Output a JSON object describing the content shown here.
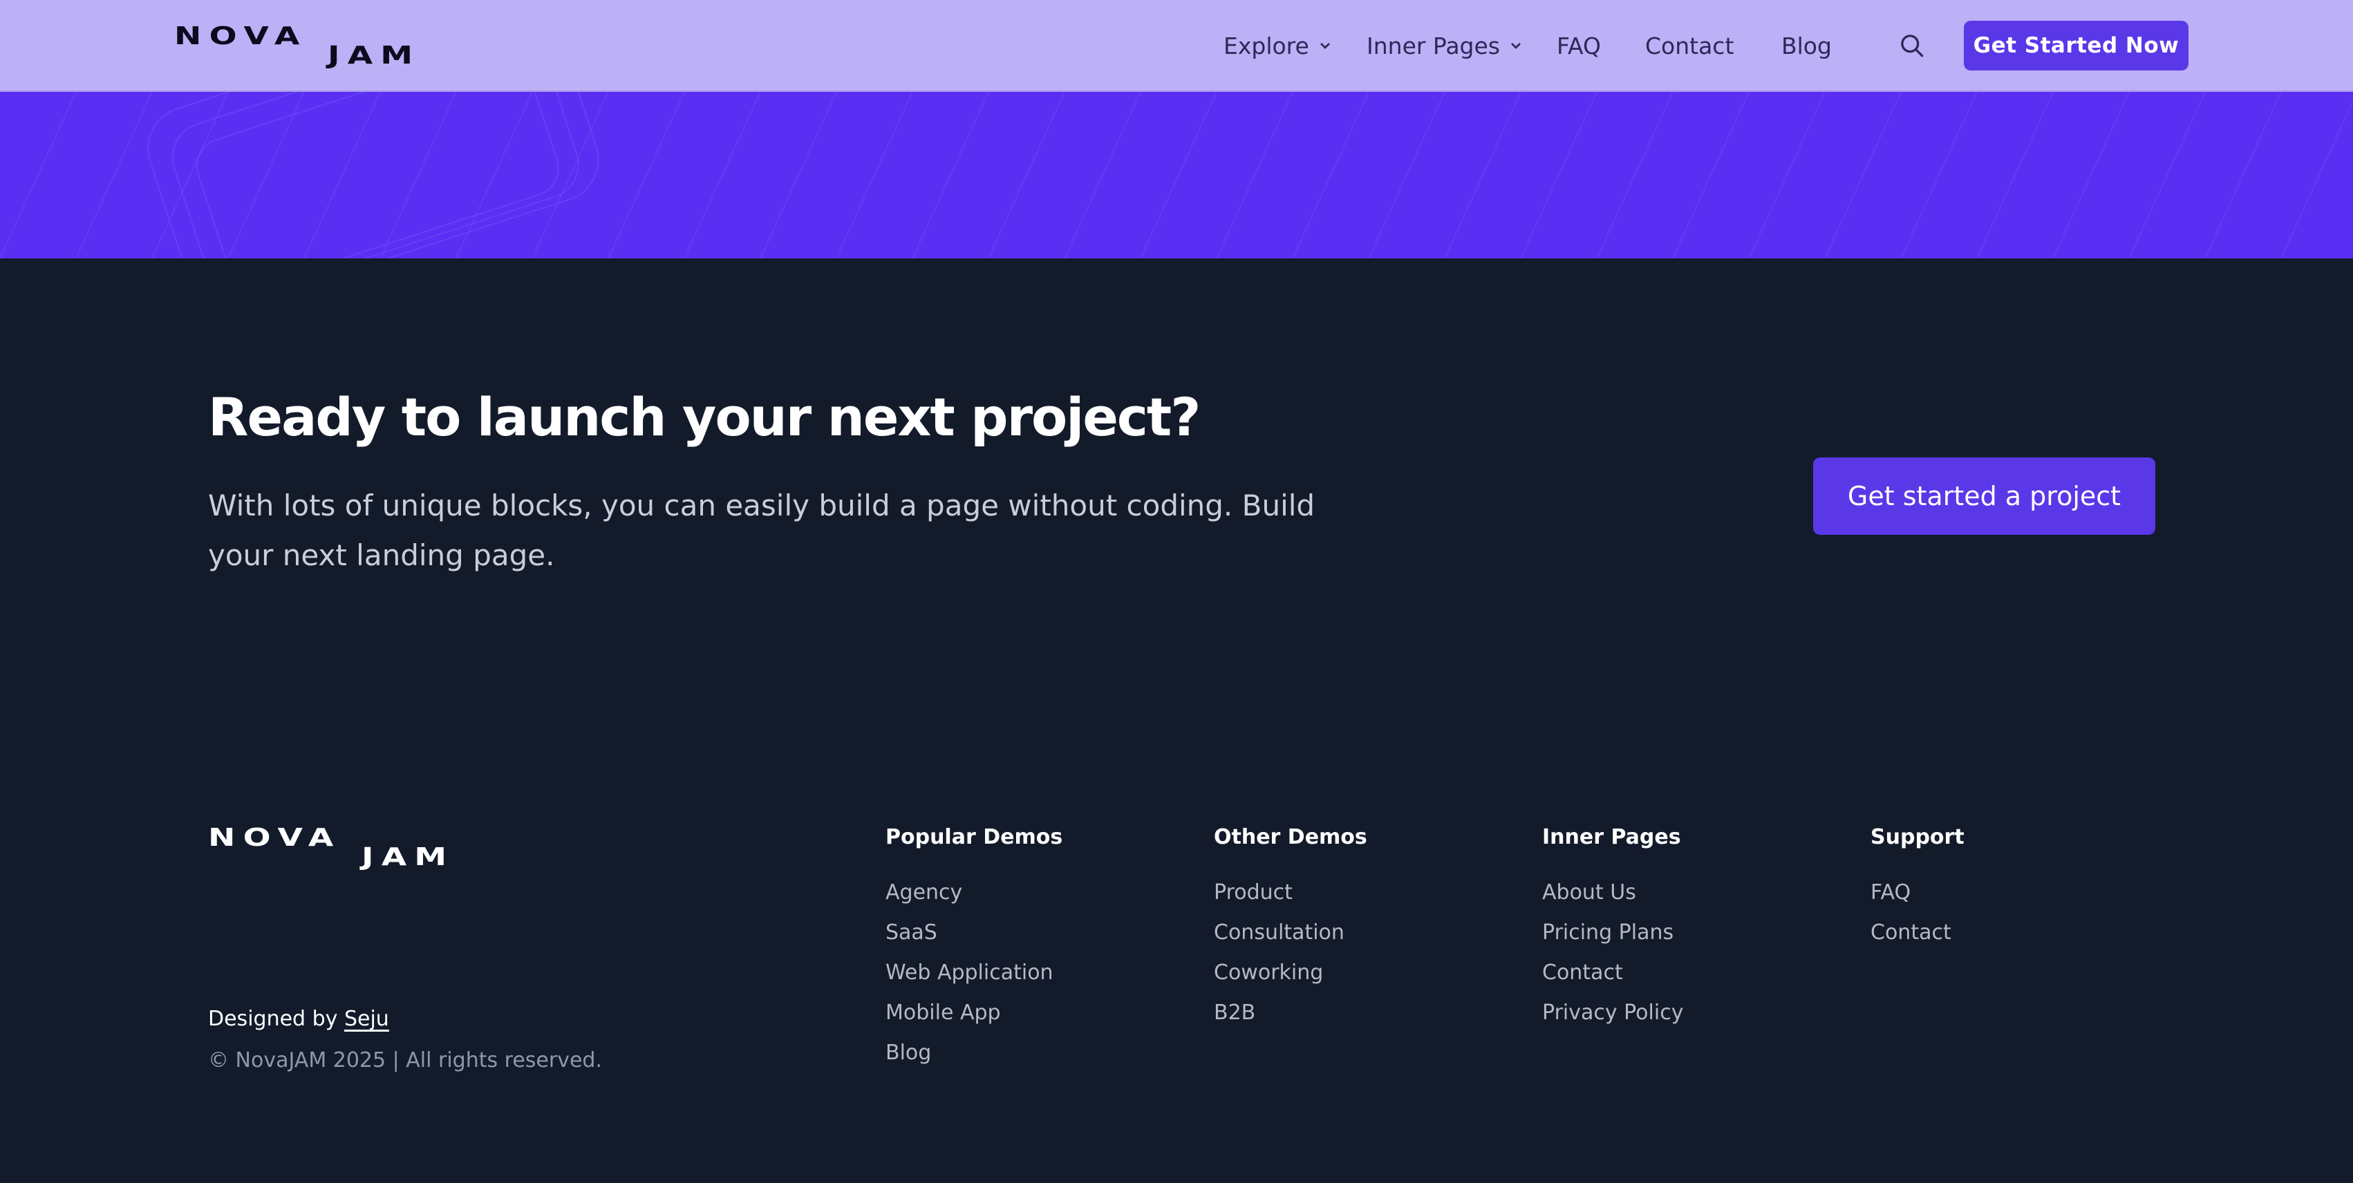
{
  "brand": {
    "word1": "NOVA",
    "word2": "JAM"
  },
  "nav": {
    "items": [
      {
        "label": "Explore",
        "has_dropdown": true
      },
      {
        "label": "Inner Pages",
        "has_dropdown": true
      },
      {
        "label": "FAQ",
        "has_dropdown": false
      },
      {
        "label": "Contact",
        "has_dropdown": false
      },
      {
        "label": "Blog",
        "has_dropdown": false
      }
    ],
    "search_icon": "search-icon",
    "cta_label": "Get Started Now"
  },
  "cta": {
    "title": "Ready to launch your next project?",
    "text": "With lots of unique blocks, you can easily build a page without coding. Build your next landing page.",
    "button_label": "Get started a project"
  },
  "footer": {
    "designed_by_prefix": "Designed by",
    "designer": "Seju",
    "copyright": "© NovaJAM 2025 | All rights reserved.",
    "columns": [
      {
        "heading": "Popular Demos",
        "links": [
          "Agency",
          "SaaS",
          "Web Application",
          "Mobile App",
          "Blog"
        ]
      },
      {
        "heading": "Other Demos",
        "links": [
          "Product",
          "Consultation",
          "Coworking",
          "B2B"
        ]
      },
      {
        "heading": "Inner Pages",
        "links": [
          "About Us",
          "Pricing Plans",
          "Contact",
          "Privacy Policy"
        ]
      },
      {
        "heading": "Support",
        "links": [
          "FAQ",
          "Contact"
        ]
      }
    ]
  },
  "colors": {
    "navbar_bg": "#bcb0f6",
    "accent": "#5a38e8",
    "hero_band": "#5a2ef3",
    "dark_bg": "#131b2b"
  }
}
